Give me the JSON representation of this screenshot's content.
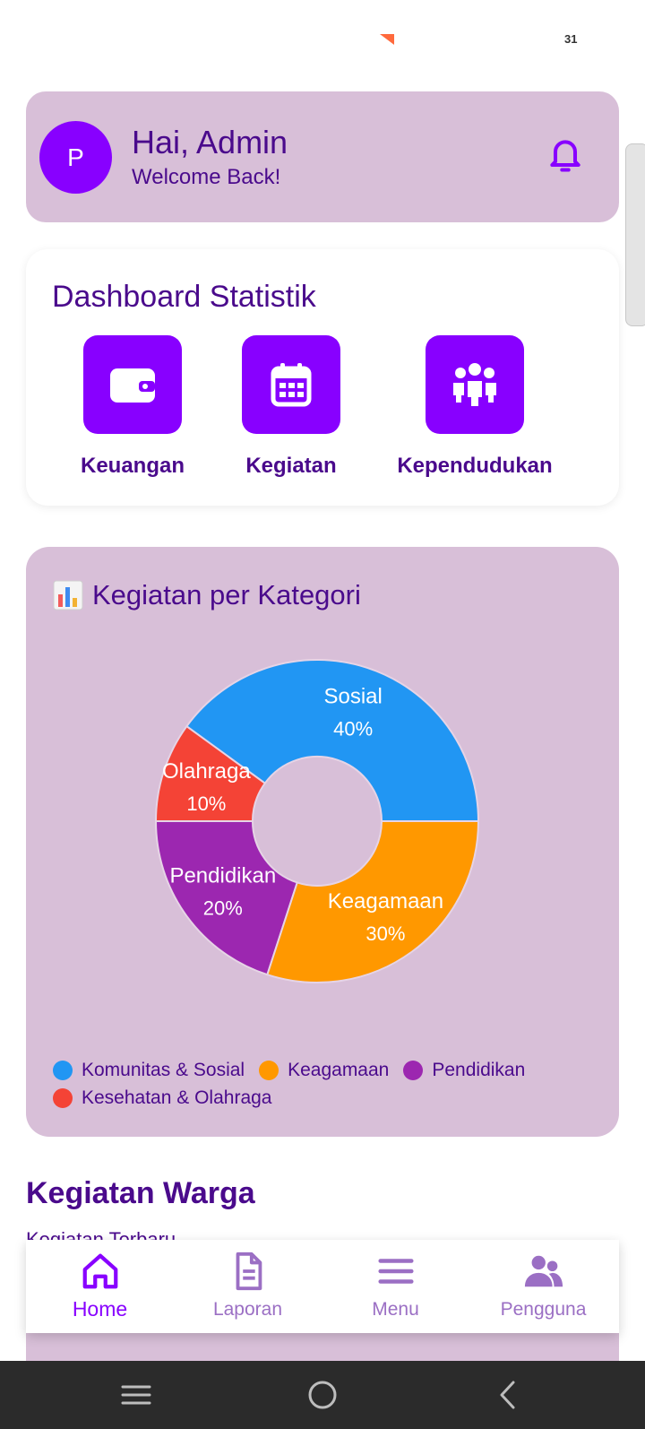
{
  "status_bar": {
    "time": "31"
  },
  "header": {
    "avatar_initial": "P",
    "greeting": "Hai, Admin",
    "subtitle": "Welcome Back!",
    "notification_icon": "bell-icon"
  },
  "stats": {
    "title": "Dashboard Statistik",
    "items": [
      {
        "label": "Keuangan",
        "icon": "wallet-icon"
      },
      {
        "label": "Kegiatan",
        "icon": "calendar-icon"
      },
      {
        "label": "Kependudukan",
        "icon": "people-icon"
      }
    ]
  },
  "chart_card": {
    "emoji": "bar-chart-emoji",
    "title": "Kegiatan per Kategori"
  },
  "chart_data": {
    "type": "pie",
    "donut": true,
    "slices": [
      {
        "label": "Sosial",
        "value": 40,
        "display": "40%",
        "color": "#2196f3"
      },
      {
        "label": "Olahraga",
        "value": 10,
        "display": "10%",
        "color": "#f44336"
      },
      {
        "label": "Pendidikan",
        "value": 20,
        "display": "20%",
        "color": "#9c27b0"
      },
      {
        "label": "Keagamaan",
        "value": 30,
        "display": "30%",
        "color": "#ff9800"
      }
    ],
    "legend": [
      {
        "label": "Komunitas & Sosial",
        "color": "#2196f3"
      },
      {
        "label": "Keagamaan",
        "color": "#ff9800"
      },
      {
        "label": "Pendidikan",
        "color": "#9c27b0"
      },
      {
        "label": "Kesehatan & Olahraga",
        "color": "#f44336"
      }
    ],
    "legend_position": "bottom"
  },
  "section": {
    "title": "Kegiatan Warga",
    "subtitle": "Kegiatan Terbaru"
  },
  "bottom_nav": {
    "items": [
      {
        "label": "Home",
        "icon": "home-icon",
        "active": true
      },
      {
        "label": "Laporan",
        "icon": "document-icon",
        "active": false
      },
      {
        "label": "Menu",
        "icon": "menu-icon",
        "active": false
      },
      {
        "label": "Pengguna",
        "icon": "users-icon",
        "active": false
      }
    ]
  },
  "colors": {
    "primary": "#8800ff",
    "dark_purple": "#4a0a8c",
    "card_lilac": "#d8bfd8",
    "inactive_nav": "#9b6fc4"
  }
}
